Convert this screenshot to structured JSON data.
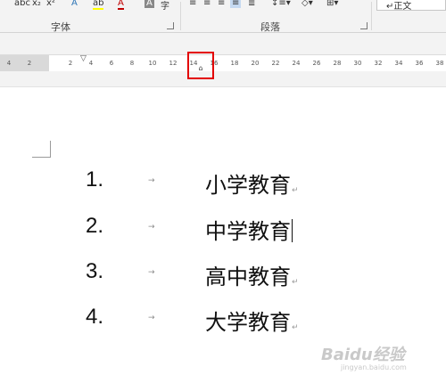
{
  "ribbon": {
    "font_buttons": [
      "abc",
      "x₂",
      "x²",
      "A",
      "ab",
      "A",
      "A",
      "字"
    ],
    "font_group_label": "字体",
    "para_group_label": "段落",
    "style_box_label": "↵正文"
  },
  "ruler": {
    "ticks": [
      "4",
      "2",
      "2",
      "4",
      "6",
      "8",
      "10",
      "12",
      "14",
      "16",
      "18",
      "20",
      "22",
      "24",
      "26",
      "28",
      "30",
      "32",
      "34",
      "36",
      "38"
    ],
    "tab_marker_icon": "left-tab-stop-icon"
  },
  "list": {
    "items": [
      {
        "number": "1.",
        "text": "小学教育"
      },
      {
        "number": "2.",
        "text": "中学教育"
      },
      {
        "number": "3.",
        "text": "高中教育"
      },
      {
        "number": "4.",
        "text": "大学教育"
      }
    ],
    "tab_glyph": "→",
    "para_mark": "↵"
  },
  "watermark": {
    "text": "Baidu经验",
    "url": "jingyan.baidu.com"
  },
  "colors": {
    "highlight_box": "#e30000"
  }
}
